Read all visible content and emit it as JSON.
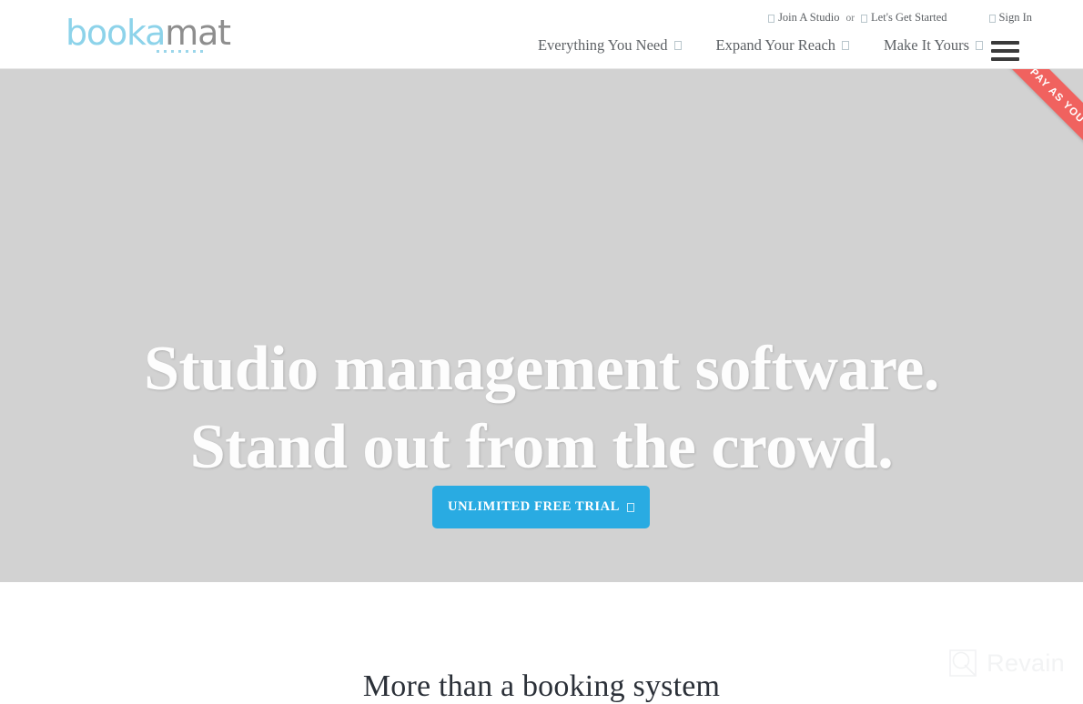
{
  "brand": {
    "logo_part1": "booka",
    "logo_part2": "mat",
    "logo_blue": "#67cbe8",
    "logo_gray": "#8e8e8e"
  },
  "topbar": {
    "join_studio": "Join A Studio",
    "or": "or",
    "get_started": "Let's Get Started",
    "sign_in": "Sign In",
    "join_icon": "box-glyph-icon",
    "get_started_icon": "box-glyph-icon",
    "sign_in_icon": "box-glyph-icon"
  },
  "nav": {
    "items": [
      {
        "label": "Everything You Need",
        "icon": "chevron-down-icon"
      },
      {
        "label": "Expand Your Reach",
        "icon": "chevron-down-icon"
      },
      {
        "label": "Make It Yours",
        "icon": "chevron-down-icon"
      }
    ],
    "menu_icon": "hamburger-menu-icon"
  },
  "hero": {
    "ribbon": "PAY AS YOU GROW",
    "ribbon_color": "#f0625f",
    "title_line1": "Studio management software.",
    "title_line2": "Stand out from the crowd.",
    "cta_label": "UNLIMITED FREE TRIAL",
    "cta_icon": "arrow-right-icon",
    "cta_color": "#29abe2",
    "background_color": "#d2d2d2"
  },
  "section": {
    "heading": "More than a booking system"
  },
  "watermark": {
    "label": "Revain",
    "icon": "revain-logo-icon"
  }
}
